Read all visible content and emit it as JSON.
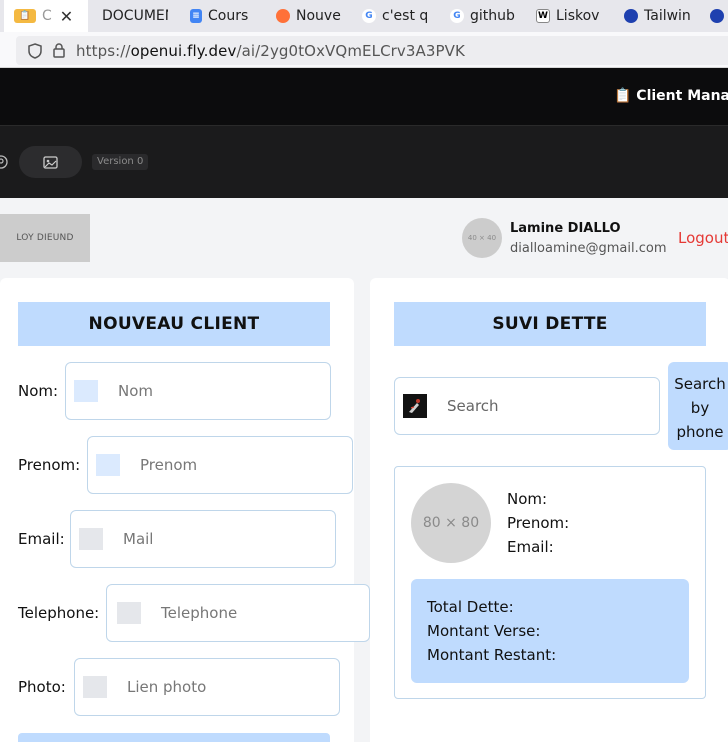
{
  "browser": {
    "tabs": [
      {
        "label": "C",
        "favicon": "app-clipboard-icon",
        "active": true
      },
      {
        "label": "DOCUMENT",
        "favicon": "none"
      },
      {
        "label": "Cours",
        "favicon": "google-docs-icon"
      },
      {
        "label": "Nouve",
        "favicon": "firefox-icon"
      },
      {
        "label": "c'est q",
        "favicon": "google-icon"
      },
      {
        "label": "github",
        "favicon": "google-icon"
      },
      {
        "label": "Liskov",
        "favicon": "wikipedia-icon"
      },
      {
        "label": "Tailwin",
        "favicon": "tailwind-icon"
      }
    ],
    "url_prefix": "https://",
    "url_host": "openui.fly.dev",
    "url_path": "/ai/2yg0tOxVQmELCrv3A3PVK"
  },
  "app": {
    "title": "📋 Client Manage",
    "version_label": "Version 0"
  },
  "header": {
    "logo_text": "LOY DIEUND",
    "avatar_placeholder": "40 × 40",
    "user_name": "Lamine DIALLO",
    "user_email": "dialloamine@gmail.com",
    "logout_label": "Logout"
  },
  "new_client": {
    "title": "NOUVEAU CLIENT",
    "fields": [
      {
        "label": "Nom:",
        "placeholder": "Nom"
      },
      {
        "label": "Prenom:",
        "placeholder": "Prenom"
      },
      {
        "label": "Email:",
        "placeholder": "Mail"
      },
      {
        "label": "Telephone:",
        "placeholder": "Telephone"
      },
      {
        "label": "Photo:",
        "placeholder": "Lien photo"
      }
    ]
  },
  "suivi": {
    "title": "SUVI DETTE",
    "search_placeholder": "Search",
    "search_button_lines": [
      "Search",
      "by",
      "phone"
    ],
    "avatar_placeholder": "80 × 80",
    "client_lines": [
      "Nom:",
      "Prenom:",
      "Email:"
    ],
    "dette_lines": [
      "Total Dette:",
      "Montant Verse:",
      "Montant Restant:"
    ]
  },
  "colors": {
    "accent_light_blue": "#bfdbfe",
    "logout_red": "#e53935",
    "dark_header": "#0c0c0d"
  }
}
